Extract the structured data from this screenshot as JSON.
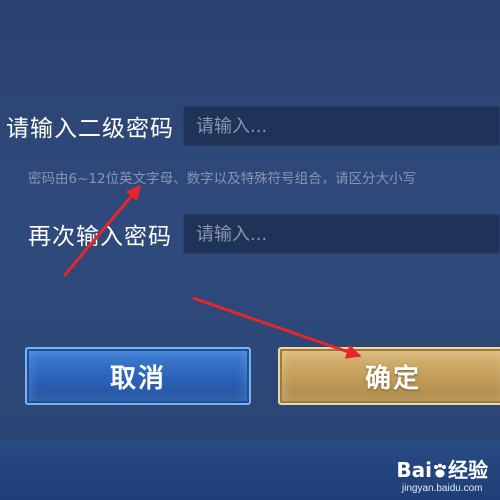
{
  "form": {
    "password_label": "请输入二级密码",
    "password_placeholder": "请输入...",
    "hint": "密码由6~12位英文字母、数字以及特殊符号组合，请区分大小写",
    "confirm_label": "再次输入密码",
    "confirm_placeholder": "请输入..."
  },
  "buttons": {
    "cancel": "取消",
    "confirm": "确定"
  },
  "watermark": {
    "logo_prefix": "Bai",
    "logo_suffix": "经验",
    "url": "jingyan.baidu.com"
  },
  "colors": {
    "background": "#2e4a7c",
    "cancel_button": "#3a74cc",
    "confirm_button": "#c9a663",
    "annotation_arrow": "#e8262a"
  },
  "icons": {
    "annotation": "red-arrow-icon",
    "watermark": "baidu-paw-icon"
  }
}
